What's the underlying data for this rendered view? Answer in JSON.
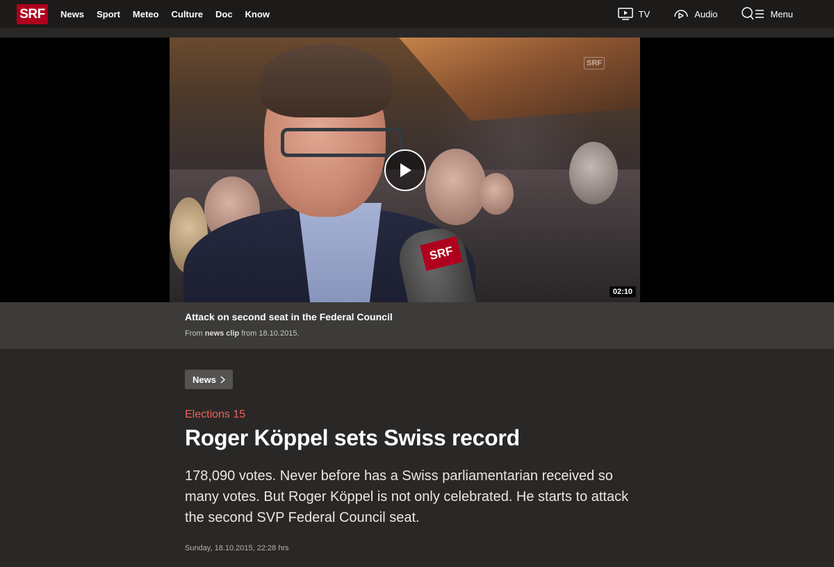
{
  "nav": {
    "logo": "SRF",
    "links": [
      "News",
      "Sport",
      "Meteo",
      "Culture",
      "Doc",
      "Know"
    ],
    "tv_label": "TV",
    "audio_label": "Audio",
    "menu_label": "Menu"
  },
  "video": {
    "watermark": "SRF",
    "mic_tag": "SRF",
    "duration": "02:10",
    "title": "Attack on second seat in the Federal Council",
    "meta_prefix": "From",
    "meta_source": "news clip",
    "meta_suffix": "from 18.10.2015."
  },
  "article": {
    "breadcrumb": "News",
    "kicker": "Elections 15",
    "headline": "Roger Köppel sets Swiss record",
    "lead": "178,090 votes. Never before has a Swiss parliamentarian received so many votes. But Roger Köppel is not only celebrated. He starts to attack the second SVP Federal Council seat.",
    "date": "Sunday, 18.10.2015, 22:28 hrs"
  },
  "colors": {
    "brand_red": "#af001d",
    "kicker_red": "#f0605c",
    "page_bg": "#2a2826"
  }
}
